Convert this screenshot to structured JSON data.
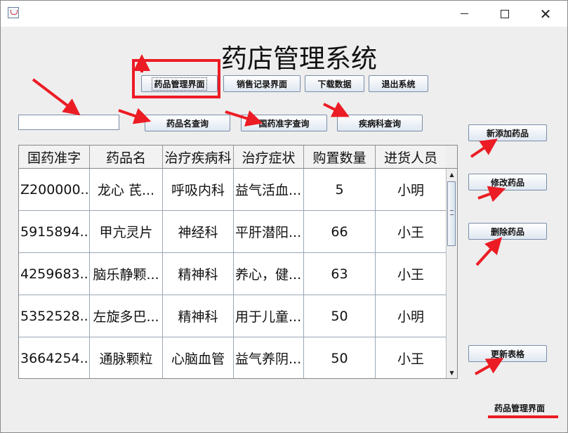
{
  "window": {
    "title": "",
    "controls": {
      "minimize": "minimize-icon",
      "maximize": "maximize-icon",
      "close": "✕"
    }
  },
  "header": {
    "title": "药店管理系统"
  },
  "nav": {
    "drug_mgmt": "药品管理界面",
    "sales_record": "销售记录界面",
    "download": "下载数据",
    "exit": "退出系统"
  },
  "search": {
    "value": "",
    "by_name": "药品名查询",
    "by_approval": "国药准字查询",
    "by_dept": "疾病科查询"
  },
  "actions": {
    "add": "新添加药品",
    "edit": "修改药品",
    "delete": "删除药品",
    "refresh": "更新表格"
  },
  "table": {
    "columns": [
      "国药准字",
      "药品名",
      "治疗疾病科",
      "治疗症状",
      "购置数量",
      "进货人员"
    ],
    "rows": [
      [
        "Z200000...",
        "龙心 芪...",
        "呼吸内科",
        "益气活血...",
        "5",
        "小明"
      ],
      [
        "5915894...",
        "甲亢灵片",
        "神经科",
        "平肝潜阳...",
        "66",
        "小王"
      ],
      [
        "4259683...",
        "脑乐静颗...",
        "精神科",
        "养心，健...",
        "63",
        "小王"
      ],
      [
        "5352528...",
        "左旋多巴...",
        "精神科",
        "用于儿童...",
        "50",
        "小明"
      ],
      [
        "3664254...",
        "通脉颗粒",
        "心脑血管",
        "益气养阴...",
        "50",
        "小王"
      ]
    ]
  },
  "status": {
    "current_view": "药品管理界面"
  },
  "annotation_color": "#ec1c24"
}
